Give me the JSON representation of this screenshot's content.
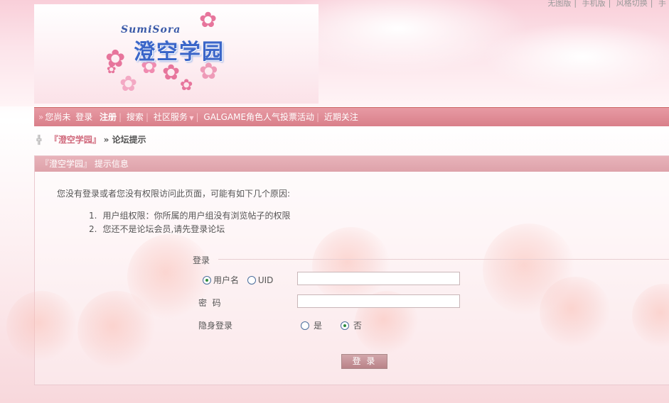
{
  "top_links": [
    "无图版",
    "手机版",
    "风格切换",
    "手"
  ],
  "logo": {
    "en": "SumiSora",
    "cn": "澄空学园"
  },
  "menu": {
    "prefix": "您尚未",
    "login": "登录",
    "register": "注册",
    "search": "搜索",
    "community": "社区服务",
    "event": "GALGAME角色人气投票活动",
    "recent": "近期关注"
  },
  "breadcrumb": {
    "site": "『澄空学园』",
    "current": "» 论坛提示"
  },
  "panel": {
    "title": "『澄空学园』 提示信息",
    "message": "您没有登录或者您没有权限访问此页面，可能有如下几个原因:",
    "reasons": [
      {
        "num": "1.",
        "text": "用户组权限：你所属的用户组没有浏览帖子的权限"
      },
      {
        "num": "2.",
        "text": "您还不是论坛会员,请先登录论坛"
      }
    ]
  },
  "login_form": {
    "legend": "登录",
    "username_option": "用户名",
    "uid_option": "UID",
    "username_value": "",
    "password_label": "密  码",
    "password_value": "",
    "hidden_label": "隐身登录",
    "hidden_yes": "是",
    "hidden_no": "否",
    "submit_label": "登 录"
  },
  "colors": {
    "menu_bar": "#d97f8a",
    "panel_head": "#e8b3ba",
    "accent": "#d0687b"
  },
  "icons": {
    "home": "plus-home-icon",
    "menu_arrow": "double-chevron-icon",
    "dropdown": "caret-down-icon"
  }
}
